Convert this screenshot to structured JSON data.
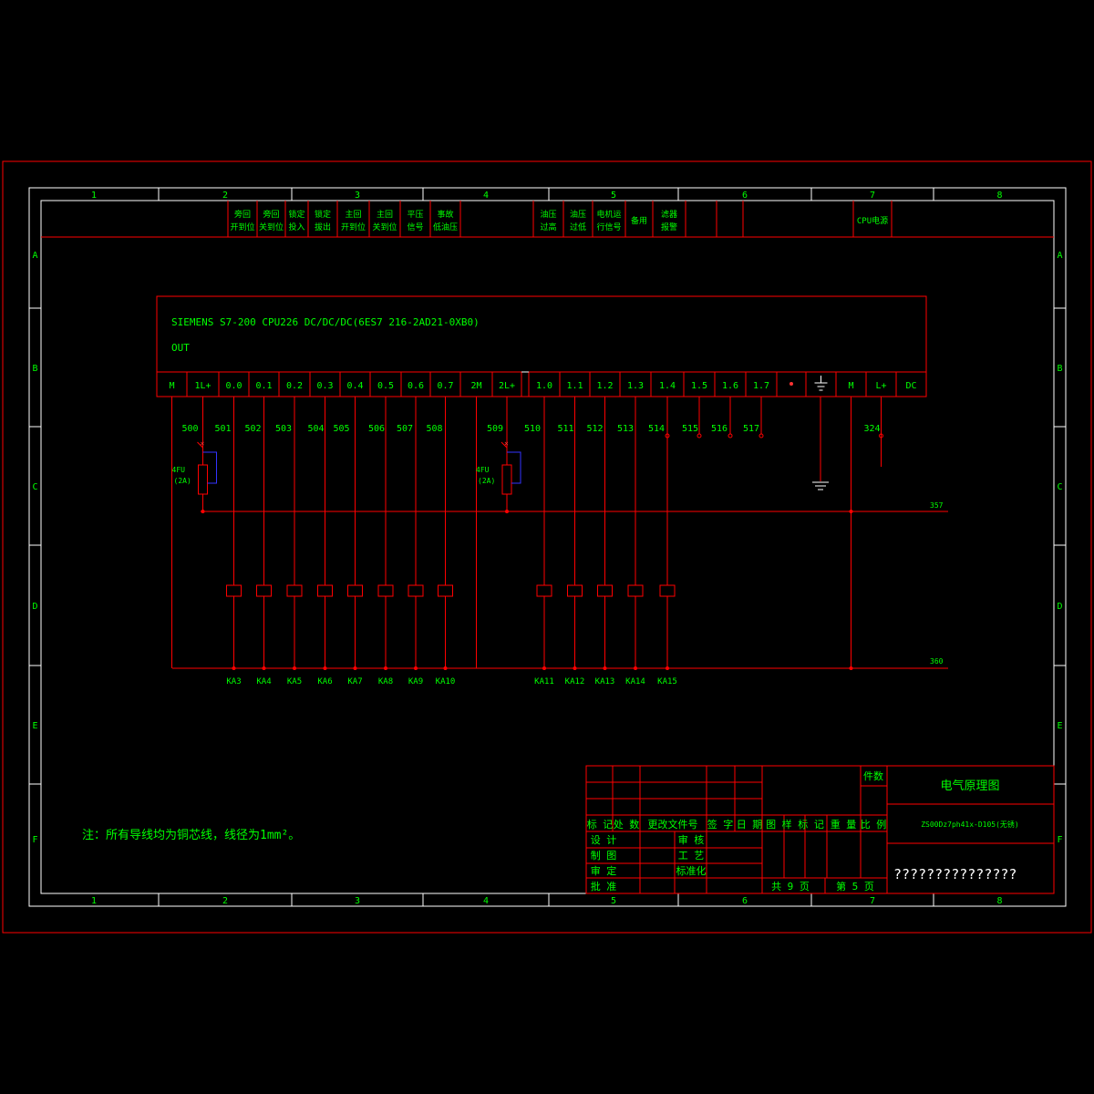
{
  "colors": {
    "background": "#000000",
    "line": "#ff0000",
    "frame": "#ffffff",
    "text": "#00ff00"
  },
  "grid_cols": [
    "1",
    "2",
    "3",
    "4",
    "5",
    "6",
    "7",
    "8"
  ],
  "grid_rows": [
    "A",
    "B",
    "C",
    "D",
    "E",
    "F"
  ],
  "header_labels": [
    {
      "l1": "旁回",
      "l2": "开到位"
    },
    {
      "l1": "旁回",
      "l2": "关到位"
    },
    {
      "l1": "锁定",
      "l2": "投入"
    },
    {
      "l1": "锁定",
      "l2": "拔出"
    },
    {
      "l1": "主回",
      "l2": "开到位"
    },
    {
      "l1": "主回",
      "l2": "关到位"
    },
    {
      "l1": "平压",
      "l2": "信号"
    },
    {
      "l1": "事故",
      "l2": "低油压"
    },
    {
      "l1": "油压",
      "l2": "过高"
    },
    {
      "l1": "油压",
      "l2": "过低"
    },
    {
      "l1": "电机运",
      "l2": "行信号"
    },
    {
      "l1": "备用",
      "l2": ""
    },
    {
      "l1": "滤器",
      "l2": "报警"
    },
    {
      "l1": "CPU电源",
      "l2": ""
    }
  ],
  "plc": {
    "title": "SIEMENS S7-200  CPU226 DC/DC/DC(6ES7 216-2AD21-0XB0)",
    "out_label": "OUT",
    "terminals_left": [
      "M",
      "1L+",
      "0.0",
      "0.1",
      "0.2",
      "0.3",
      "0.4",
      "0.5",
      "0.6",
      "0.7",
      "2M",
      "2L+"
    ],
    "terminals_right": [
      "1.0",
      "1.1",
      "1.2",
      "1.3",
      "1.4",
      "1.5",
      "1.6",
      "1.7",
      "",
      "",
      "M",
      "L+",
      "DC"
    ]
  },
  "wire_numbers": [
    "500",
    "501",
    "502",
    "503",
    "504",
    "505",
    "506",
    "507",
    "508",
    "509",
    "510",
    "511",
    "512",
    "513",
    "514",
    "515",
    "516",
    "517",
    "324"
  ],
  "fuse_labels": [
    {
      "l1": "4FU",
      "l2": "(2A)"
    },
    {
      "l1": "4FU",
      "l2": "(2A)"
    }
  ],
  "bus_labels": {
    "top": "357",
    "bottom": "360"
  },
  "relays": [
    "KA3",
    "KA4",
    "KA5",
    "KA6",
    "KA7",
    "KA8",
    "KA9",
    "KA10",
    "KA11",
    "KA12",
    "KA13",
    "KA14",
    "KA15"
  ],
  "note": "注：所有导线均为铜芯线，线径为1mm²。",
  "title_block": {
    "jianshu": "件数",
    "drawing_title": "电气原理图",
    "drawing_code": "ZS00Dz7ph41x-D105(无锈)",
    "question_marks": "???????????????",
    "row_headers": [
      "标 记",
      "处 数",
      "更改文件号",
      "签 字",
      "日 期"
    ],
    "chart_headers": [
      "图 样 标 记",
      "重 量",
      "比 例"
    ],
    "sign_rows": [
      {
        "a": "设 计",
        "b": "审 核"
      },
      {
        "a": "制 图",
        "b": "工 艺"
      },
      {
        "a": "审 定",
        "b": "标准化"
      },
      {
        "a": "批 准",
        "b": ""
      }
    ],
    "total_pages": "共 9 页",
    "page_no": "第 5 页"
  }
}
